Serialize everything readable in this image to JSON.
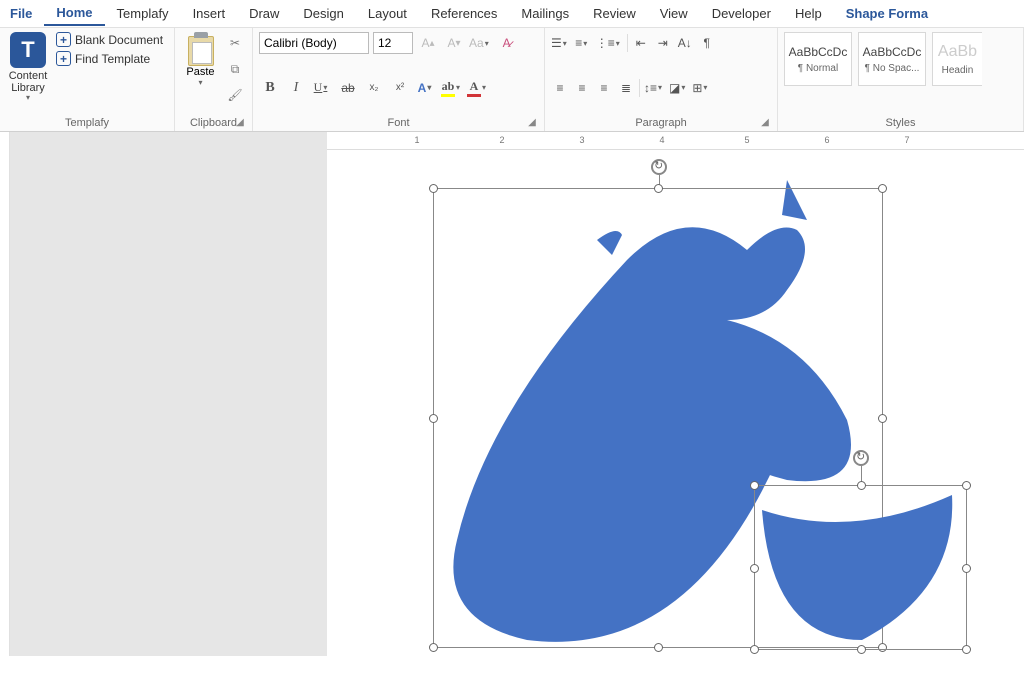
{
  "tabs": {
    "file": "File",
    "home": "Home",
    "templafy": "Templafy",
    "insert": "Insert",
    "draw": "Draw",
    "design": "Design",
    "layout": "Layout",
    "references": "References",
    "mailings": "Mailings",
    "review": "Review",
    "view": "View",
    "developer": "Developer",
    "help": "Help",
    "shape_format": "Shape Forma"
  },
  "templafy": {
    "content_library": "Content Library",
    "blank_doc": "Blank Document",
    "find_template": "Find Template",
    "group_label": "Templafy"
  },
  "clipboard": {
    "paste": "Paste",
    "group_label": "Clipboard"
  },
  "font": {
    "family": "Calibri (Body)",
    "size": "12",
    "group_label": "Font"
  },
  "paragraph": {
    "group_label": "Paragraph"
  },
  "styles": {
    "normal_prev": "AaBbCcDc",
    "normal_lbl": "¶ Normal",
    "nospace_prev": "AaBbCcDc",
    "nospace_lbl": "¶ No Spac...",
    "heading_prev": "AaBb",
    "heading_lbl": "Headin",
    "group_label": "Styles"
  },
  "ruler": {
    "numbers": [
      "1",
      "2",
      "3",
      "4",
      "5",
      "6",
      "7"
    ]
  }
}
